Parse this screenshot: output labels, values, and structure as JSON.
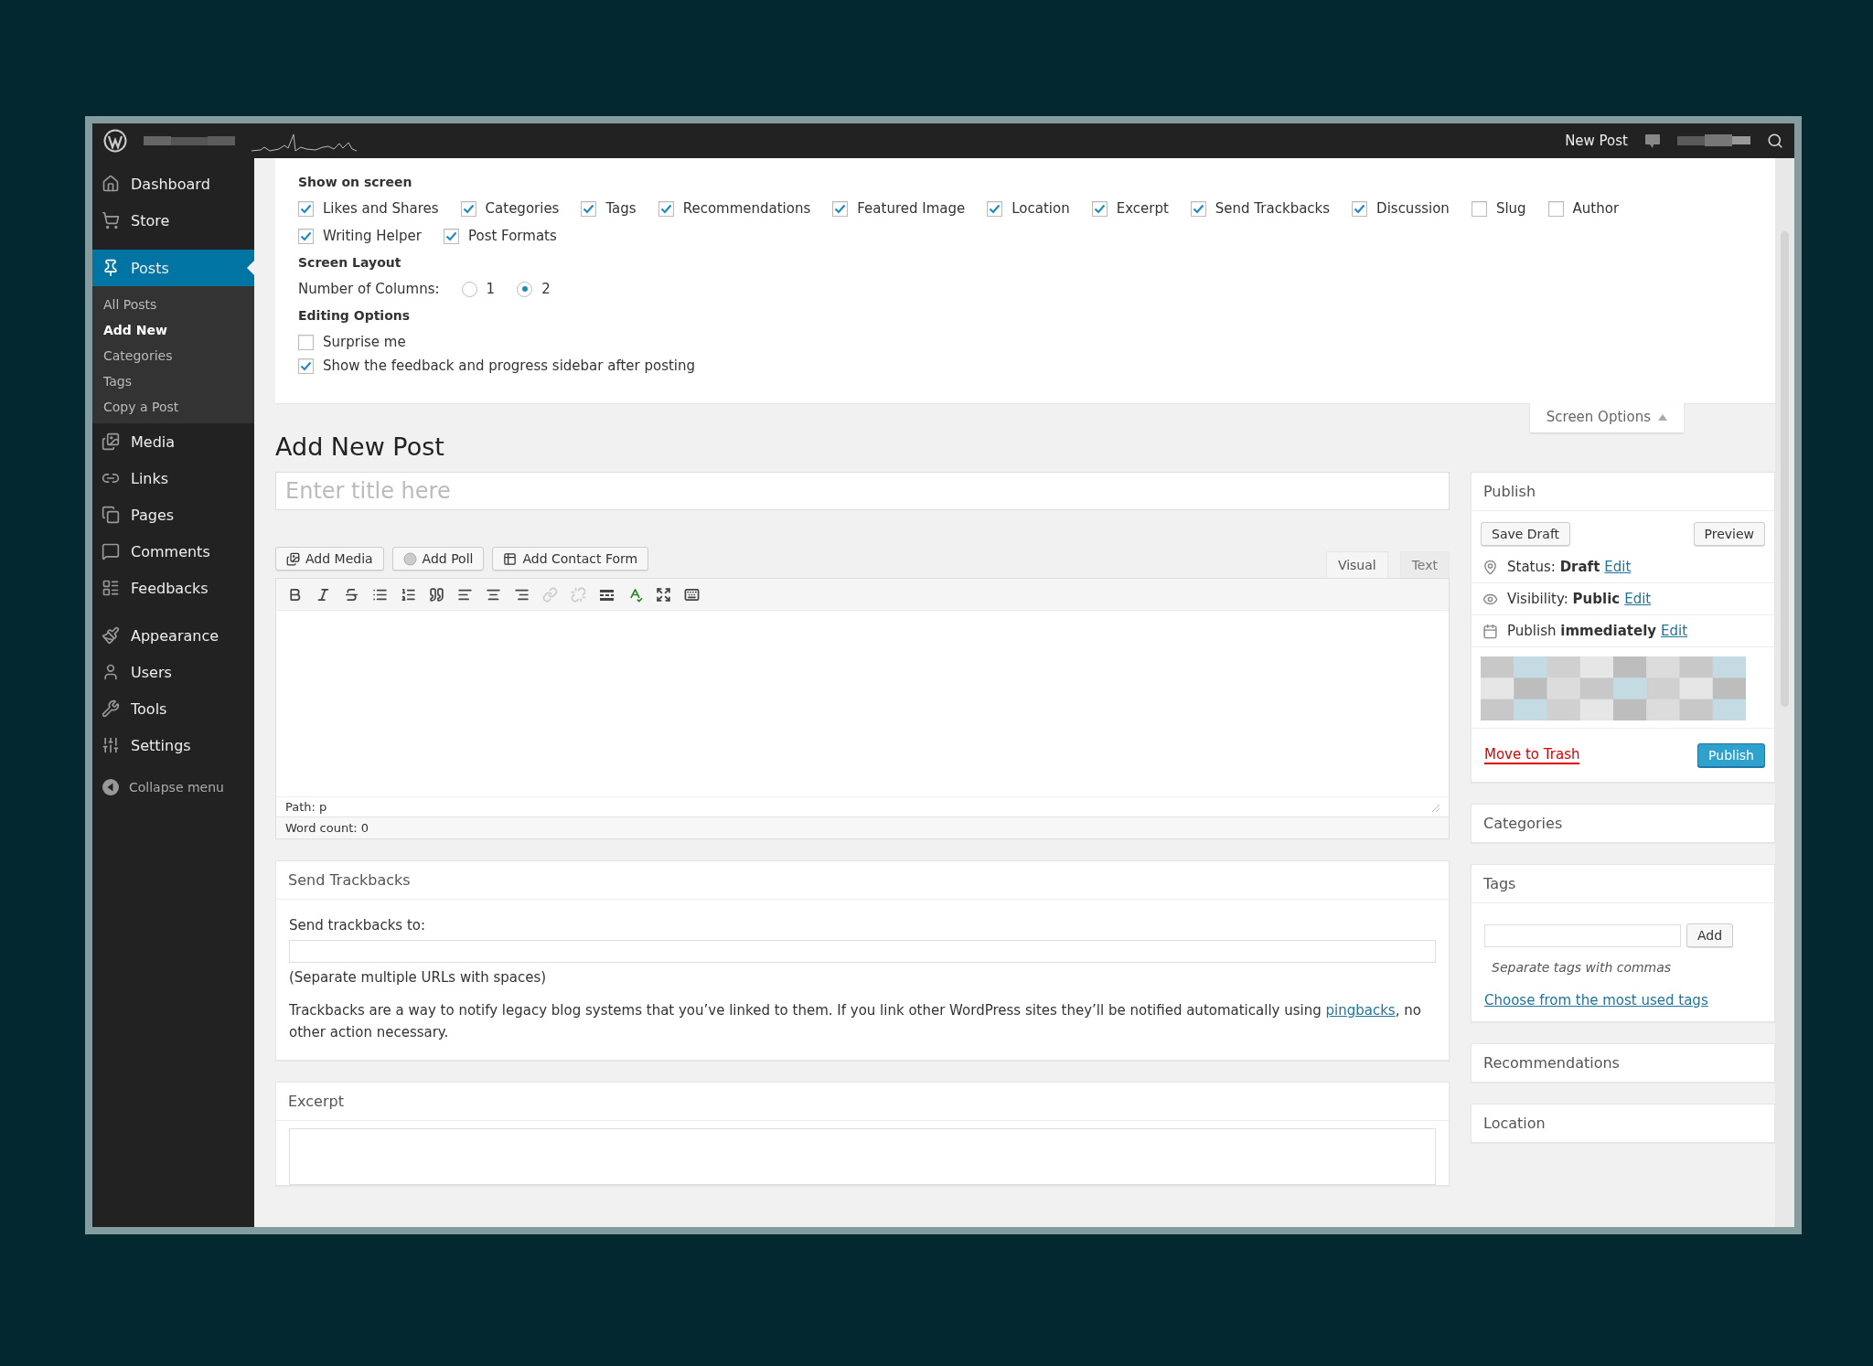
{
  "admin_bar": {
    "new_link": "New Post"
  },
  "sidebar": {
    "groups": [
      {
        "items": [
          {
            "label": "Dashboard",
            "selected": false
          },
          {
            "label": "Store",
            "selected": false
          }
        ]
      },
      {
        "items": [
          {
            "label": "Posts",
            "selected": true,
            "children": [
              {
                "label": "All Posts",
                "selected": false
              },
              {
                "label": "Add New",
                "selected": true
              },
              {
                "label": "Categories",
                "selected": false
              },
              {
                "label": "Tags",
                "selected": false
              },
              {
                "label": "Copy a Post",
                "selected": false
              }
            ]
          },
          {
            "label": "Media",
            "selected": false
          },
          {
            "label": "Links",
            "selected": false
          },
          {
            "label": "Pages",
            "selected": false
          },
          {
            "label": "Comments",
            "selected": false
          },
          {
            "label": "Feedbacks",
            "selected": false
          }
        ]
      },
      {
        "items": [
          {
            "label": "Appearance",
            "selected": false
          },
          {
            "label": "Users",
            "selected": false
          },
          {
            "label": "Tools",
            "selected": false
          },
          {
            "label": "Settings",
            "selected": false
          }
        ]
      }
    ],
    "collapse": "Collapse menu"
  },
  "screen_options": {
    "show_on_screen": {
      "heading": "Show on screen",
      "rows": [
        [
          {
            "label": "Likes and Shares",
            "checked": true
          },
          {
            "label": "Categories",
            "checked": true
          },
          {
            "label": "Tags",
            "checked": true
          },
          {
            "label": "Recommendations",
            "checked": true
          },
          {
            "label": "Featured Image",
            "checked": true
          },
          {
            "label": "Location",
            "checked": true
          },
          {
            "label": "Excerpt",
            "checked": true
          },
          {
            "label": "Send Trackbacks",
            "checked": true
          },
          {
            "label": "Discussion",
            "checked": true
          },
          {
            "label": "Slug",
            "checked": false
          },
          {
            "label": "Author",
            "checked": false
          }
        ],
        [
          {
            "label": "Writing Helper",
            "checked": true
          },
          {
            "label": "Post Formats",
            "checked": true
          }
        ]
      ]
    },
    "screen_layout": {
      "heading": "Screen Layout",
      "label": "Number of Columns:",
      "choices": [
        {
          "label": "1",
          "selected": false
        },
        {
          "label": "2",
          "selected": true
        }
      ]
    },
    "editing_options": {
      "heading": "Editing Options",
      "options": [
        {
          "label": "Surprise me",
          "checked": false
        },
        {
          "label": "Show the feedback and progress sidebar after posting",
          "checked": true
        }
      ]
    },
    "tab": "Screen Options"
  },
  "page_title": "Add New Post",
  "editor": {
    "title_placeholder": "Enter title here",
    "media_buttons": [
      "Add Media",
      "Add Poll",
      "Add Contact Form"
    ],
    "tabs": [
      {
        "label": "Visual",
        "selected": true
      },
      {
        "label": "Text",
        "selected": false
      }
    ],
    "toolbar": [
      {
        "disabled": false
      },
      {
        "disabled": false
      },
      {
        "disabled": false
      },
      {
        "disabled": false
      },
      {
        "disabled": false
      },
      {
        "disabled": false
      },
      {
        "disabled": false
      },
      {
        "disabled": false
      },
      {
        "disabled": false
      },
      {
        "disabled": true
      },
      {
        "disabled": true
      },
      {
        "disabled": false
      },
      {
        "disabled": false
      },
      {
        "disabled": false
      },
      {
        "disabled": false
      }
    ],
    "path": "Path: p",
    "word_count": "Word count: 0"
  },
  "trackbacks": {
    "title": "Send Trackbacks",
    "label": "Send trackbacks to:",
    "hint": "(Separate multiple URLs with spaces)",
    "text_before": "Trackbacks are a way to notify legacy blog systems that you’ve linked to them. If you link other WordPress sites they’ll be notified automatically using ",
    "link": "pingbacks",
    "text_after": ", no other action necessary."
  },
  "excerpt": {
    "title": "Excerpt"
  },
  "publish": {
    "title": "Publish",
    "save_draft": "Save Draft",
    "preview": "Preview",
    "rows": [
      {
        "label": "Status:",
        "value": "Draft",
        "link": "Edit"
      },
      {
        "label": "Visibility:",
        "value": "Public",
        "link": "Edit"
      },
      {
        "label": "Publish",
        "value": "immediately",
        "link": "Edit"
      }
    ],
    "trash": "Move to Trash",
    "publish_button": "Publish"
  },
  "categories": {
    "title": "Categories"
  },
  "tags": {
    "title": "Tags",
    "add": "Add",
    "hint": "Separate tags with commas",
    "link": "Choose from the most used tags"
  },
  "recommendations": {
    "title": "Recommendations"
  },
  "location": {
    "title": "Location"
  }
}
